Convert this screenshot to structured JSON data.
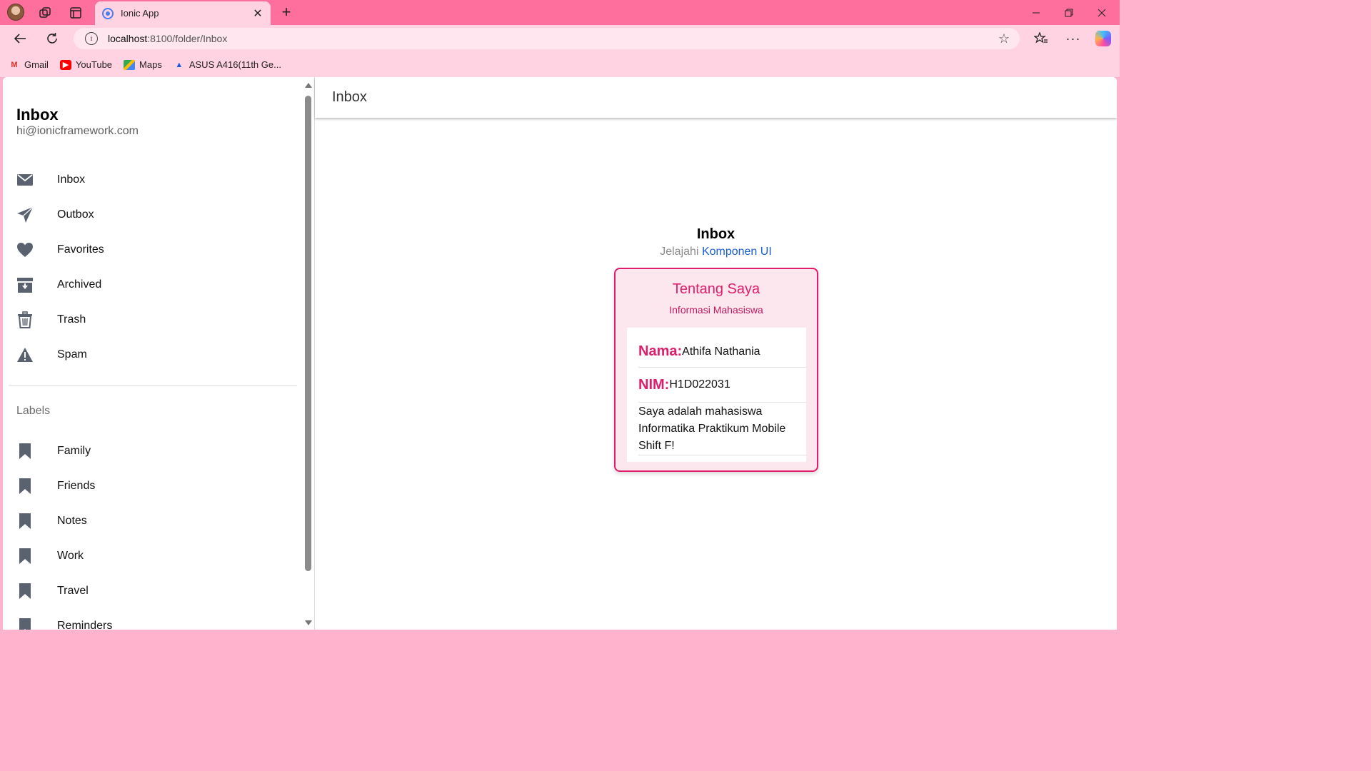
{
  "browser": {
    "tab_title": "Ionic App",
    "url_host": "localhost",
    "url_rest": ":8100/folder/Inbox",
    "bookmarks": [
      {
        "label": "Gmail",
        "icon": "gmail-icon"
      },
      {
        "label": "YouTube",
        "icon": "youtube-icon"
      },
      {
        "label": "Maps",
        "icon": "maps-icon"
      },
      {
        "label": "ASUS A416(11th Ge...",
        "icon": "asus-icon"
      }
    ]
  },
  "menu": {
    "title": "Inbox",
    "note": "hi@ionicframework.com",
    "items": [
      {
        "label": "Inbox",
        "icon": "mail-icon"
      },
      {
        "label": "Outbox",
        "icon": "paper-plane-icon"
      },
      {
        "label": "Favorites",
        "icon": "heart-icon"
      },
      {
        "label": "Archived",
        "icon": "archive-icon"
      },
      {
        "label": "Trash",
        "icon": "trash-icon"
      },
      {
        "label": "Spam",
        "icon": "warning-icon"
      }
    ],
    "labels_header": "Labels",
    "labels": [
      {
        "label": "Family",
        "icon": "bookmark-icon"
      },
      {
        "label": "Friends",
        "icon": "bookmark-icon"
      },
      {
        "label": "Notes",
        "icon": "bookmark-icon"
      },
      {
        "label": "Work",
        "icon": "bookmark-icon"
      },
      {
        "label": "Travel",
        "icon": "bookmark-icon"
      },
      {
        "label": "Reminders",
        "icon": "bookmark-icon"
      }
    ]
  },
  "page": {
    "toolbar_title": "Inbox",
    "container_title": "Inbox",
    "explore_prefix": "Jelajahi",
    "explore_link": "Komponen UI"
  },
  "card": {
    "title": "Tentang Saya",
    "subtitle": "Informasi Mahasiswa",
    "name_label": "Nama:",
    "name_value": "Athifa Nathania",
    "nim_label": "NIM:",
    "nim_value": "H1D022031",
    "description": "Saya adalah mahasiswa Informatika Praktikum Mobile Shift F!"
  },
  "colors": {
    "browser_frame": "#ff6f9e",
    "accent": "#e11d6b",
    "link": "#1a5fd0"
  }
}
